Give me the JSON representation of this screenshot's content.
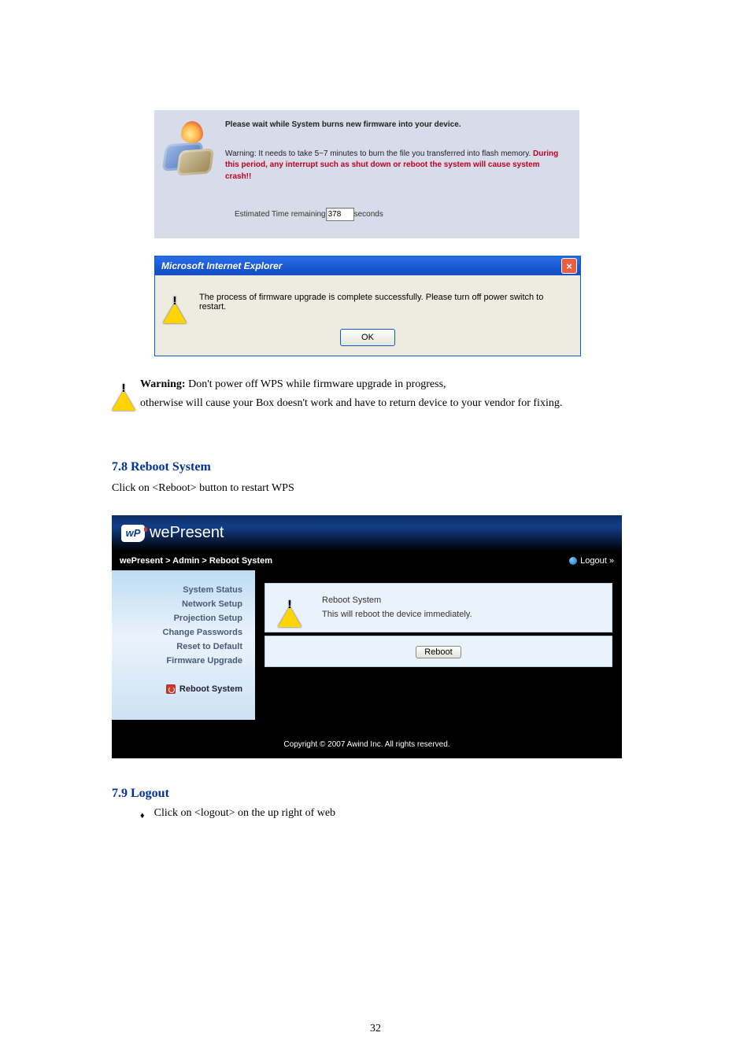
{
  "panel1": {
    "line1": "Please wait while System burns new firmware into your device.",
    "warn_prefix": "Warning: It needs to take 5~7 minutes to burn the file you transferred into flash memory. ",
    "warn_red": "During this period, any interrupt such as shut down or reboot the system will cause system crash!!",
    "remaining_label_before": "Estimated Time remaining ",
    "remaining_value": "378",
    "remaining_label_after": " seconds"
  },
  "ie_dialog": {
    "title": "Microsoft Internet Explorer",
    "message": "The process of firmware upgrade is complete successfully. Please turn off power switch to restart.",
    "ok": "OK"
  },
  "doc_text": {
    "prefix": "Warning: ",
    "rest_1": "Don't power off WPS while firmware upgrade in progress,",
    "rest_2": "otherwise will cause your Box doesn't work and have to return device to your vendor for fixing."
  },
  "section": {
    "heading": "7.8 Reboot System",
    "sub": "Click on <Reboot> button to restart WPS"
  },
  "wp": {
    "wp_text": "wP",
    "brand": "wePresent",
    "crumb": "wePresent > Admin > Reboot System",
    "logout": "Logout »",
    "sidebar": {
      "items": [
        "System Status",
        "Network Setup",
        "Projection Setup",
        "Change Passwords",
        "Reset to Default",
        "Firmware Upgrade"
      ],
      "active": "Reboot System"
    },
    "card": {
      "line1": "Reboot System",
      "line2": "This will reboot the device immediately."
    },
    "reboot_btn": "Reboot",
    "footer": "Copyright © 2007 Awind Inc. All rights reserved."
  },
  "logout_section": {
    "heading": "7.9 Logout",
    "bullet_mark": "♦",
    "text": "Click on <logout> on the up right of web"
  },
  "page_num": "32"
}
